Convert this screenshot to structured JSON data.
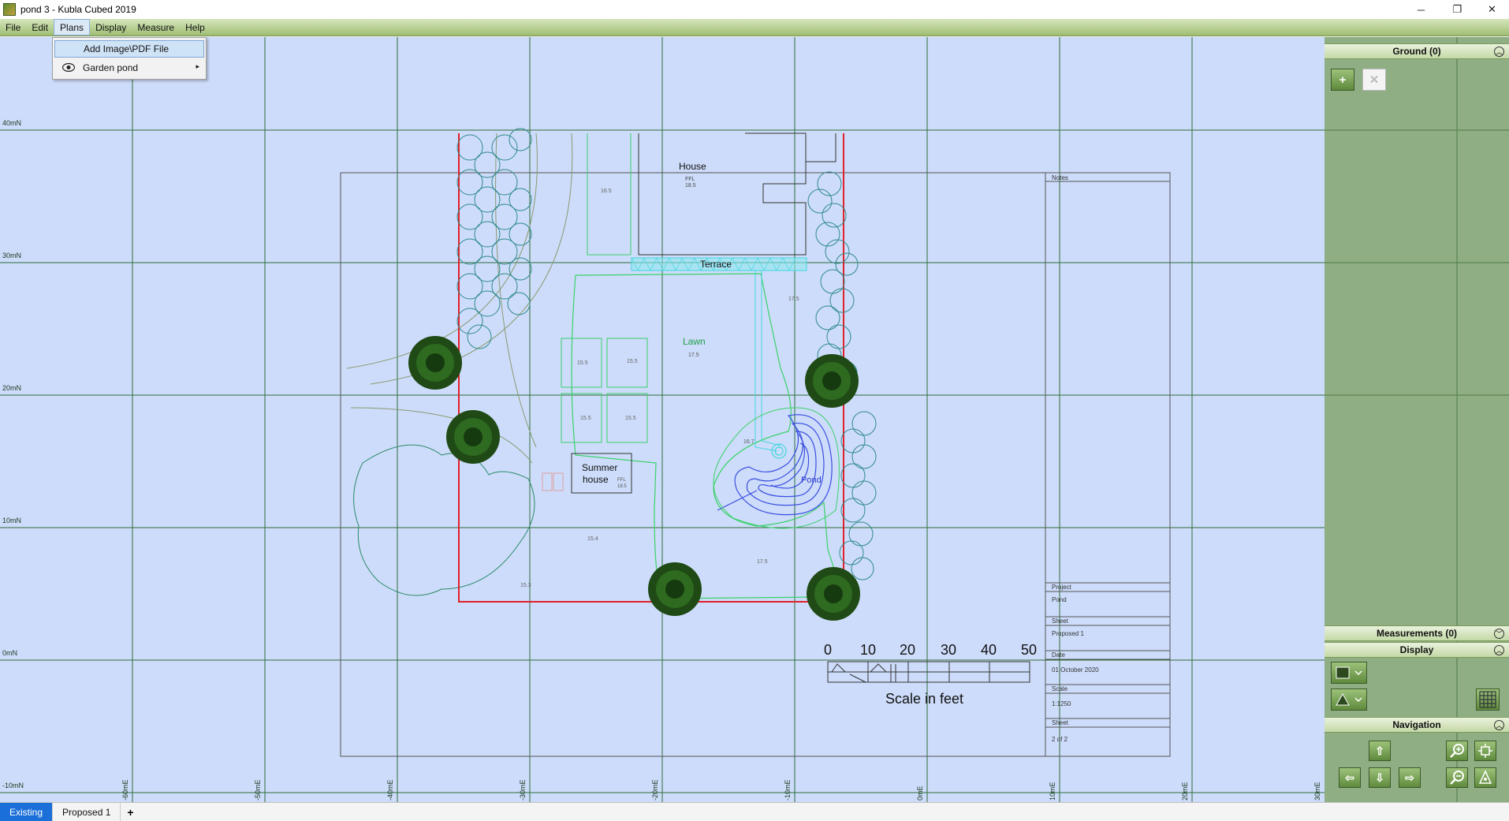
{
  "window": {
    "title": "pond 3 - Kubla Cubed 2019",
    "minimize": "─",
    "restore": "❐",
    "close": "✕"
  },
  "menubar": {
    "items": [
      "File",
      "Edit",
      "Plans",
      "Display",
      "Measure",
      "Help"
    ]
  },
  "plans_menu": {
    "add_image": "Add Image\\PDF File",
    "garden_pond": "Garden pond",
    "submenu_arrow": "▸"
  },
  "plan": {
    "northing_labels": [
      "40mN",
      "30mN",
      "20mN",
      "10mN",
      "0mN",
      "-10mN"
    ],
    "easting_labels": [
      "-60mE",
      "-50mE",
      "-40mE",
      "-30mE",
      "-20mE",
      "-10mE",
      "0mE",
      "10mE",
      "20mE",
      "30mE"
    ],
    "labels": {
      "house": "House",
      "house_ffl": "FFL",
      "house_ffl_value": "18.5",
      "terrace": "Terrace",
      "lawn": "Lawn",
      "lawn_level": "17.5",
      "summer_house_line1": "Summer",
      "summer_house_line2": "house",
      "summer_ffl": "FFL",
      "summer_ffl_value": "18.5",
      "pond": "Pond",
      "pond_level": "16.7",
      "spot_levels": [
        "16.5",
        "15.5",
        "15.5",
        "15.5",
        "15.5",
        "15.4",
        "15.3",
        "17.5",
        "17.5"
      ]
    },
    "title_block": {
      "notes_label": "Notes",
      "project_label": "Project",
      "project_value": "Pond",
      "sheet_label": "Sheet",
      "sheet_value": "Proposed 1",
      "date_label": "Date",
      "date_value": "01 October 2020",
      "scale_label": "Scale",
      "scale_value": "1:1250",
      "sheet2_label": "Sheet",
      "sheet2_value": "2 of 2"
    },
    "scale_bar": {
      "ticks": [
        "0",
        "10",
        "20",
        "30",
        "40",
        "50"
      ],
      "caption": "Scale in feet"
    }
  },
  "right_panel": {
    "ground_header": "Ground (0)",
    "measurements_header": "Measurements (0)",
    "display_header": "Display",
    "navigation_header": "Navigation",
    "chevron_up": "︿",
    "chevron_down": "﹀",
    "add": "+",
    "delete": "✕"
  },
  "tabs": {
    "items": [
      "Existing",
      "Proposed 1"
    ],
    "active": "Existing",
    "add": "+"
  },
  "colors": {
    "canvas": "#cddcfa",
    "grid": "#2f6d3a",
    "boundary": "#e0202a",
    "lawn": "#3bd16a",
    "terrace": "#45d6de",
    "pond": "#3b4fe0",
    "hedge": "#3a8a8c",
    "active_tab": "#1b6fd8"
  }
}
